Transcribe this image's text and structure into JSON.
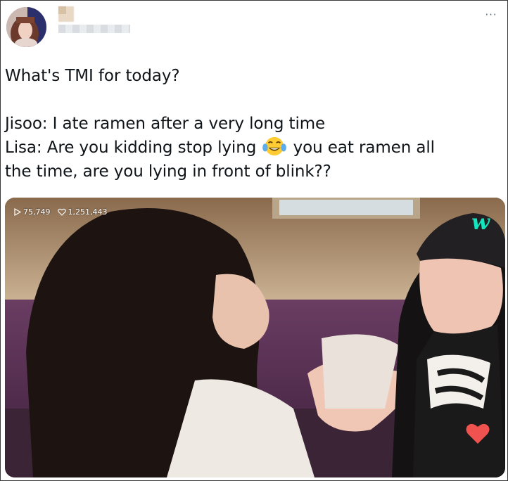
{
  "tweet": {
    "more_label": "···",
    "lines": [
      "What's TMI for today?",
      "Jisoo: I ate ramen after a very long time",
      "Lisa: Are you kidding stop lying",
      "you eat ramen all",
      "the time, are you lying in front of blink??"
    ],
    "emoji": "face-with-tears-of-joy-icon"
  },
  "media": {
    "views": "75,749",
    "likes": "1,251,443",
    "logo": "w",
    "colors": {
      "logo": "#11e6bf",
      "heart": "#f0524f"
    }
  }
}
